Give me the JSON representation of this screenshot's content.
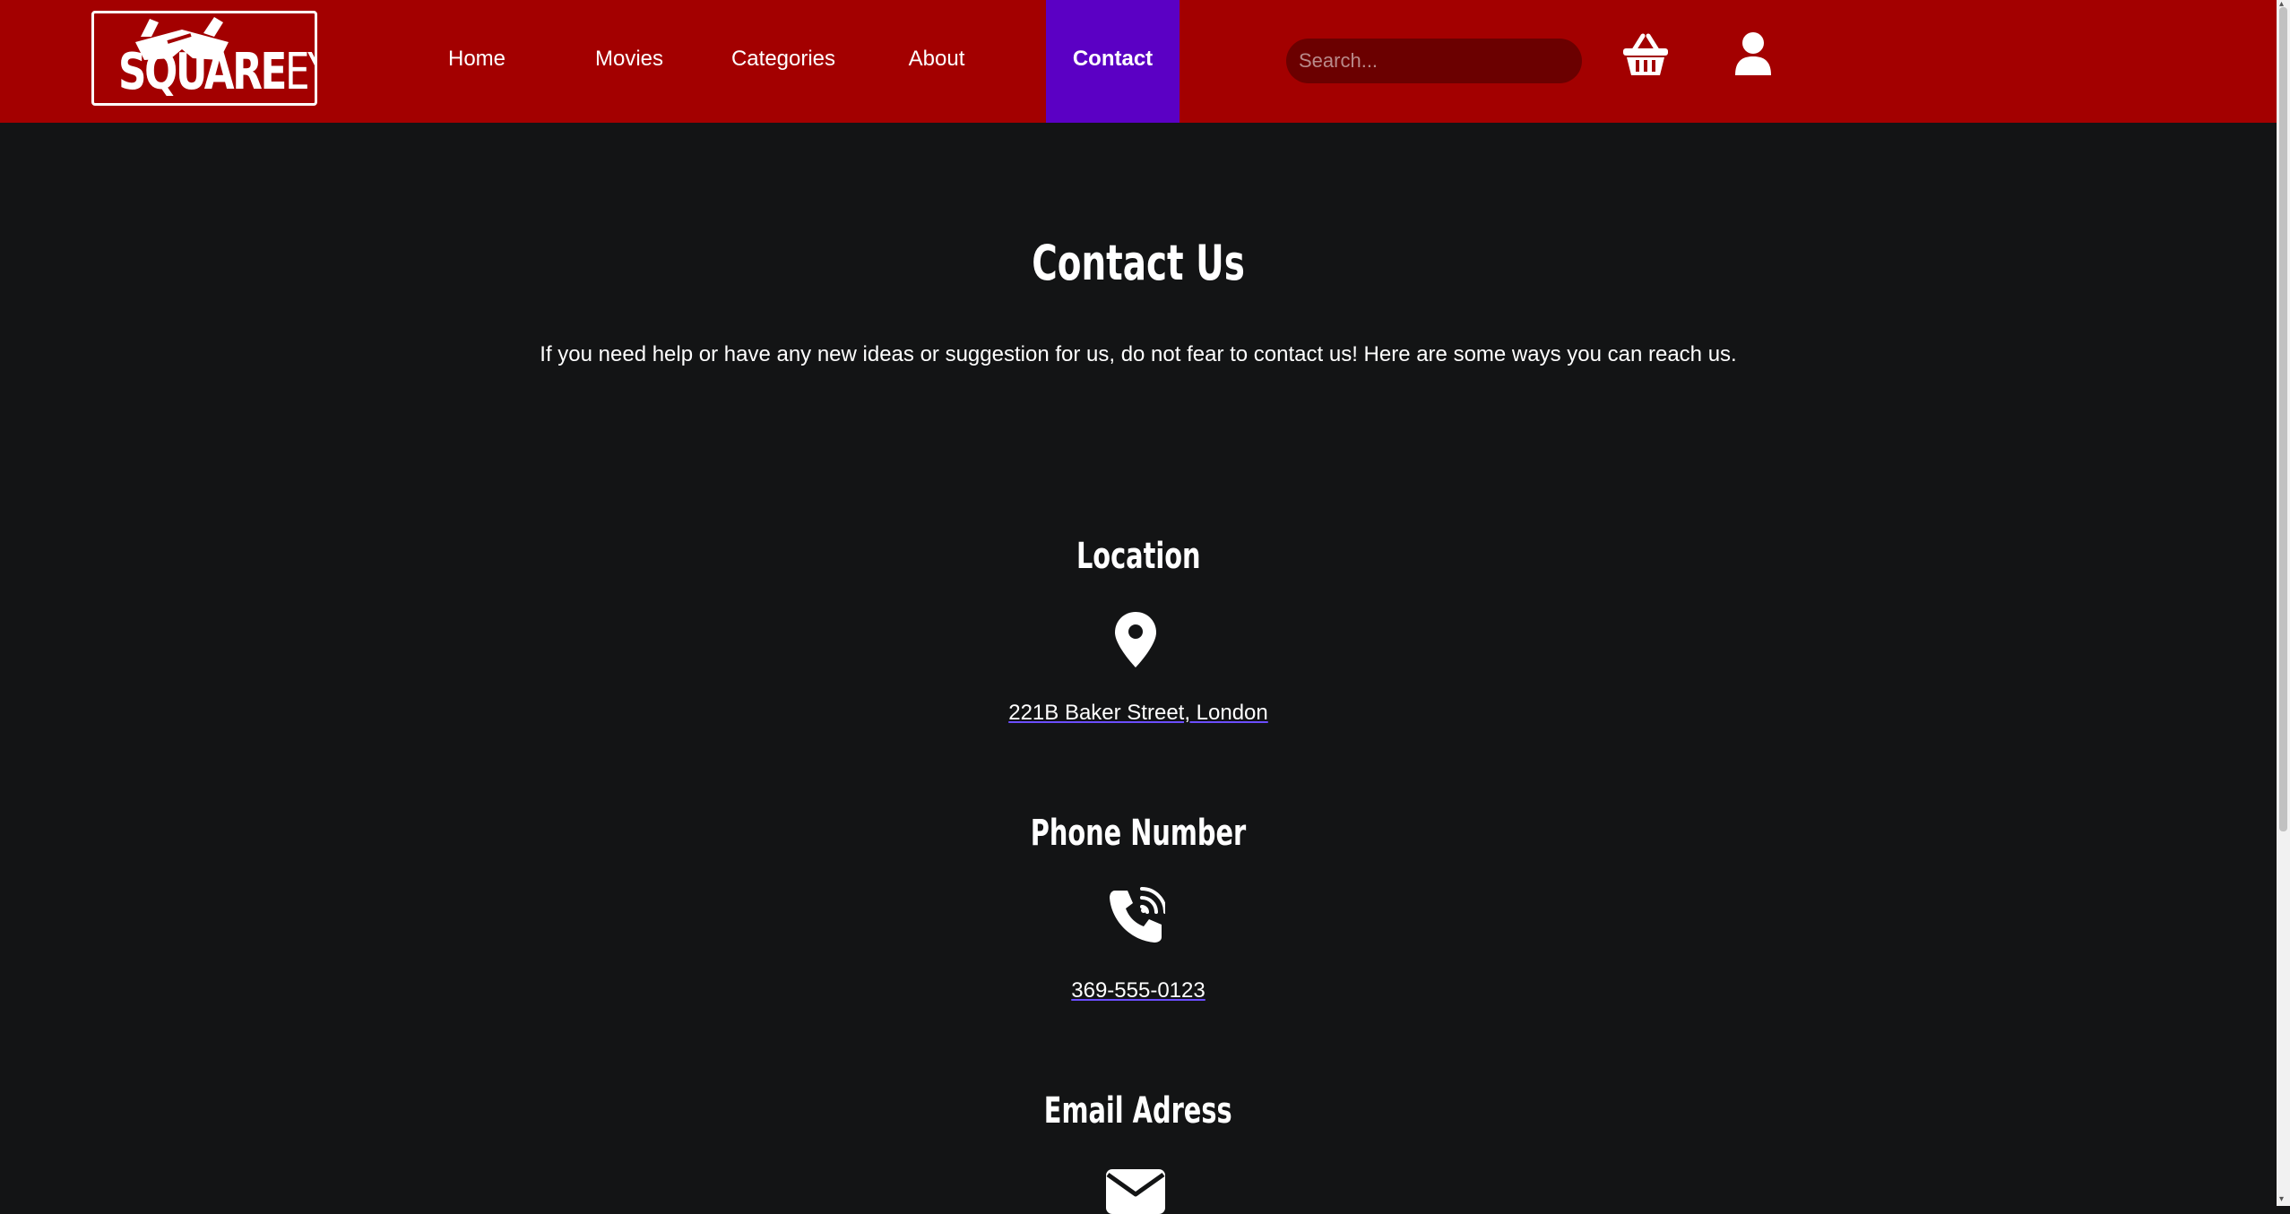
{
  "header": {
    "logo": {
      "text_bold": "SQUARE",
      "text_light": "EYES"
    },
    "nav": [
      {
        "label": "Home"
      },
      {
        "label": "Movies"
      },
      {
        "label": "Categories"
      },
      {
        "label": "About"
      },
      {
        "label": "Contact",
        "active": true
      }
    ],
    "search": {
      "placeholder": "Search...",
      "value": ""
    },
    "icons": [
      "basket-icon",
      "user-icon"
    ]
  },
  "main": {
    "title": "Contact Us",
    "intro": "If you need help or have any new ideas or suggestion for us, do not fear to contact us! Here are some ways you can reach us.",
    "sections": [
      {
        "heading": "Location",
        "icon": "map-pin-icon",
        "link": "221B Baker Street, London"
      },
      {
        "heading": "Phone Number",
        "icon": "phone-icon",
        "link": "369-555-0123"
      },
      {
        "heading": "Email Adress",
        "icon": "envelope-icon"
      }
    ]
  },
  "colors": {
    "header_bg": "#a30000",
    "active_nav": "#5b00c4",
    "page_bg": "#131415",
    "search_bg": "#6b0000"
  }
}
